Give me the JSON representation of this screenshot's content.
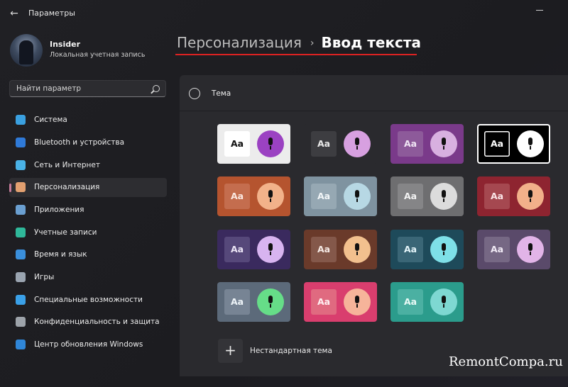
{
  "app": {
    "title": "Параметры"
  },
  "user": {
    "name": "Insider",
    "account_type": "Локальная учетная запись"
  },
  "search": {
    "placeholder": "Найти параметр"
  },
  "nav": [
    {
      "label": "Система",
      "icon": "monitor-icon",
      "color": "#3aa0e0",
      "active": false
    },
    {
      "label": "Bluetooth и устройства",
      "icon": "bluetooth-icon",
      "color": "#2f7ad8",
      "active": false
    },
    {
      "label": "Сеть и Интернет",
      "icon": "wifi-icon",
      "color": "#4ab2e6",
      "active": false
    },
    {
      "label": "Персонализация",
      "icon": "brush-icon",
      "color": "#e2a070",
      "active": true
    },
    {
      "label": "Приложения",
      "icon": "apps-icon",
      "color": "#6a9fd0",
      "active": false
    },
    {
      "label": "Учетные записи",
      "icon": "person-icon",
      "color": "#2fb89a",
      "active": false
    },
    {
      "label": "Время и язык",
      "icon": "globe-clock-icon",
      "color": "#3a8fdc",
      "active": false
    },
    {
      "label": "Игры",
      "icon": "gamepad-icon",
      "color": "#9aa4b0",
      "active": false
    },
    {
      "label": "Специальные возможности",
      "icon": "accessibility-icon",
      "color": "#3aa0e8",
      "active": false
    },
    {
      "label": "Конфиденциальность и защита",
      "icon": "shield-icon",
      "color": "#9da3aa",
      "active": false
    },
    {
      "label": "Центр обновления Windows",
      "icon": "update-icon",
      "color": "#2f86d8",
      "active": false
    }
  ],
  "breadcrumb": {
    "parent": "Персонализация",
    "separator": "›",
    "current": "Ввод текста"
  },
  "theme_section": {
    "title": "Тема",
    "icon": "palette-icon"
  },
  "themes": [
    {
      "name": "light",
      "bg": "#ececec",
      "aa_bg": "#ffffff",
      "aa_fg": "#111111",
      "mic": "#9b42c2",
      "selected": false
    },
    {
      "name": "dark",
      "bg": "#2a2a2e",
      "aa_bg": "#3d3d41",
      "aa_fg": "#e8e8e8",
      "mic": "#d7a0e0",
      "selected": false
    },
    {
      "name": "purple",
      "bg": "#7a3a8a",
      "aa_bg": "#8d5a9a",
      "aa_fg": "#f0e6f4",
      "mic": "#d8b0e0",
      "selected": false
    },
    {
      "name": "high-contrast",
      "bg": "#000000",
      "aa_bg": "#000000",
      "aa_fg": "#ffffff",
      "mic": "#ffffff",
      "selected": true
    },
    {
      "name": "rust",
      "bg": "#b5542f",
      "aa_bg": "#c46d4e",
      "aa_fg": "#fbe9e2",
      "mic": "#f2b28a",
      "selected": false
    },
    {
      "name": "steel-blue",
      "bg": "#7f93a0",
      "aa_bg": "#96a8b3",
      "aa_fg": "#f2f6f8",
      "mic": "#b7d8e4",
      "selected": false
    },
    {
      "name": "gray",
      "bg": "#6e6e70",
      "aa_bg": "#858587",
      "aa_fg": "#f4f4f4",
      "mic": "#dcdcdc",
      "selected": false
    },
    {
      "name": "red-wave",
      "bg": "#8e2430",
      "aa_bg": "#a54850",
      "aa_fg": "#fbe6e8",
      "mic": "#f2b08a",
      "selected": false
    },
    {
      "name": "violet-flow",
      "bg": "#3a2a5e",
      "aa_bg": "#56487a",
      "aa_fg": "#ece6f6",
      "mic": "#d8b4f0",
      "selected": false
    },
    {
      "name": "bronze-flow",
      "bg": "#6a3a2a",
      "aa_bg": "#84584a",
      "aa_fg": "#f6ebe6",
      "mic": "#f2c08e",
      "selected": false
    },
    {
      "name": "teal-glow",
      "bg": "#1e4a5a",
      "aa_bg": "#3a6676",
      "aa_fg": "#e6f6fa",
      "mic": "#7ee0e8",
      "selected": false
    },
    {
      "name": "mauve",
      "bg": "#5a4a6a",
      "aa_bg": "#766884",
      "aa_fg": "#f2ecf6",
      "mic": "#e2b4e8",
      "selected": false
    },
    {
      "name": "green",
      "bg": "#5c6a7a",
      "aa_bg": "#778494",
      "aa_fg": "#eef4f8",
      "mic": "#66dd88",
      "selected": false
    },
    {
      "name": "pink-orange",
      "bg": "#d93e6e",
      "aa_bg": "#e06a80",
      "aa_fg": "#fff0f2",
      "mic": "#f6b49a",
      "selected": false
    },
    {
      "name": "teal",
      "bg": "#2b9c8c",
      "aa_bg": "#4bb0a2",
      "aa_fg": "#eafaf6",
      "mic": "#7ed8d2",
      "selected": false
    }
  ],
  "theme_glyph": "Aa",
  "custom_theme": {
    "label": "Нестандартная тема",
    "icon_glyph": "+"
  },
  "watermark": "RemontCompa.ru"
}
